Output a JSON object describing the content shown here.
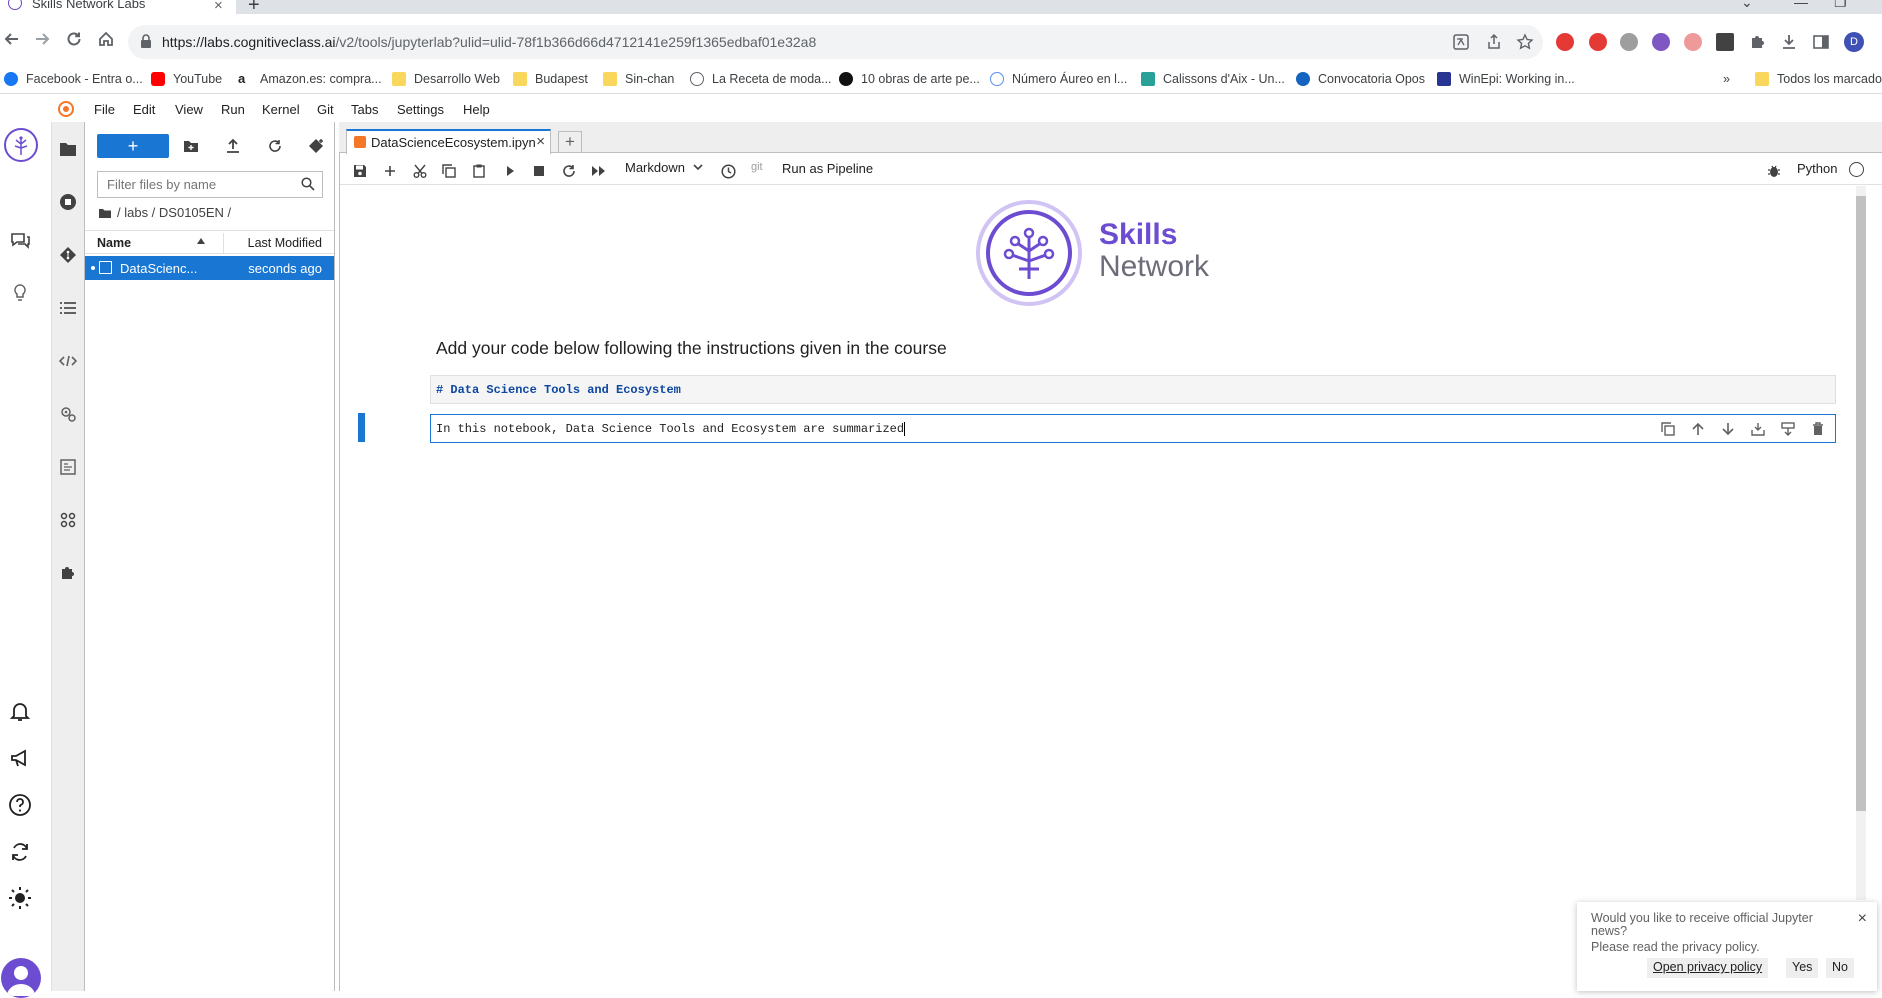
{
  "browser": {
    "tab_title": "Skills Network Labs",
    "url_host": "https://labs.cognitiveclass.ai",
    "url_path": "/v2/tools/jupyterlab?ulid=ulid-78f1b366d66d4712141e259f1365edbaf01e32a8",
    "profile_initial": "D",
    "bookmarks": [
      {
        "label": "Facebook - Entra o...",
        "icon": "facebook-icon",
        "color": "#1877f2"
      },
      {
        "label": "YouTube",
        "icon": "youtube-icon",
        "color": "#ff0000"
      },
      {
        "label": "Amazon.es: compra...",
        "icon": "amazon-icon",
        "color": "#222222"
      },
      {
        "label": "Desarrollo Web",
        "icon": "folder-icon",
        "color": "#f9d65c"
      },
      {
        "label": "Budapest",
        "icon": "folder-icon",
        "color": "#f9d65c"
      },
      {
        "label": "Sin-chan",
        "icon": "folder-icon",
        "color": "#f9d65c"
      },
      {
        "label": "La Receta de moda...",
        "icon": "globe-icon",
        "color": "#5f6368"
      },
      {
        "label": "10 obras de arte pe...",
        "icon": "site-icon",
        "color": "#111111"
      },
      {
        "label": "Número Áureo en l...",
        "icon": "site-icon",
        "color": "#5b8def"
      },
      {
        "label": "Calissons d'Aix - Un...",
        "icon": "site-icon",
        "color": "#2aa198"
      },
      {
        "label": "Convocatoria Opos",
        "icon": "site-icon",
        "color": "#1565c0"
      },
      {
        "label": "WinEpi: Working in...",
        "icon": "site-icon",
        "color": "#283593"
      }
    ],
    "bookmarks_overflow": "»",
    "all_bookmarks": "Todos los marcadores"
  },
  "jupyter": {
    "menu": [
      "File",
      "Edit",
      "View",
      "Run",
      "Kernel",
      "Git",
      "Tabs",
      "Settings",
      "Help"
    ],
    "filebrowser": {
      "new_label": "+",
      "filter_placeholder": "Filter files by name",
      "breadcrumb": "/ labs / DS0105EN /",
      "col_name": "Name",
      "col_modified": "Last Modified",
      "file_name": "DataScienc...",
      "file_modified": "seconds ago"
    },
    "doc_tab": "DataScienceEcosystem.ipyn",
    "toolbar": {
      "cell_type": "Markdown",
      "git": "git",
      "pipeline": "Run as Pipeline",
      "kernel": "Python"
    },
    "notebook": {
      "logo_title_1": "Skills",
      "logo_title_2": "Network",
      "heading": "Add your code below following the instructions given in the course",
      "cell1_source": "# Data Science Tools and Ecosystem",
      "cell2_source": "In this notebook, Data Science Tools and Ecosystem are summarized"
    },
    "notification": {
      "line1": "Would you like to receive official Jupyter news?",
      "line2": "Please read the privacy policy.",
      "open_policy": "Open privacy policy",
      "yes": "Yes",
      "no": "No"
    }
  },
  "colors": {
    "accent": "#1976d2",
    "brand_purple": "#6c4cd1"
  }
}
